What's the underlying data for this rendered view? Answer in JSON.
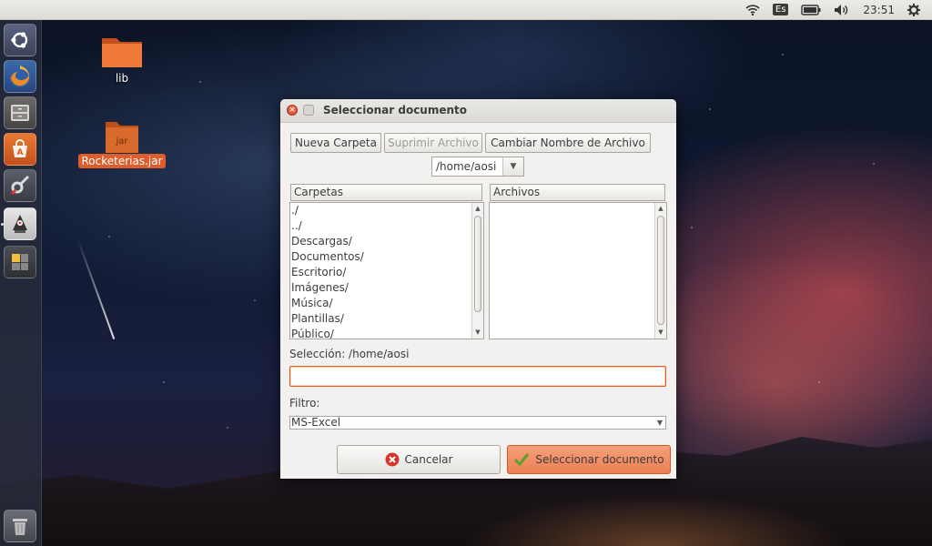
{
  "top_panel": {
    "keyboard_layout": "Es",
    "clock": "23:51",
    "icons": [
      "wifi-icon",
      "battery-icon",
      "volume-icon",
      "gear-icon"
    ]
  },
  "launcher": {
    "items": [
      "ubuntu-dash-icon",
      "firefox-icon",
      "files-icon",
      "software-center-icon",
      "system-settings-icon",
      "java-app-icon",
      "workspace-switcher-icon",
      "trash-icon"
    ]
  },
  "desktop": {
    "folder_label": "lib",
    "jar_badge": "jar",
    "jar_label": "Rocketerias.jar"
  },
  "dialog": {
    "title": "Seleccionar documento",
    "new_folder_label": "Nueva Carpeta",
    "delete_file_label": "Suprimir Archivo",
    "rename_file_label": "Cambiar Nombre de Archivo",
    "path_combo_value": "/home/aosi",
    "folders_header": "Carpetas",
    "files_header": "Archivos",
    "folders": [
      "./",
      "../",
      "Descargas/",
      "Documentos/",
      "Escritorio/",
      "Imágenes/",
      "Música/",
      "Plantillas/",
      "Público/"
    ],
    "files": [],
    "selection_label": "Selección: /home/aosi",
    "selection_value": "",
    "filter_label": "Filtro:",
    "filter_value": "MS-Excel",
    "cancel_label": "Cancelar",
    "select_label": "Seleccionar documento",
    "colors": {
      "accent": "#e0591e",
      "ok_button": "#ec7e52",
      "cancel_icon": "#d9342b",
      "check_icon": "#5aa02c"
    }
  }
}
